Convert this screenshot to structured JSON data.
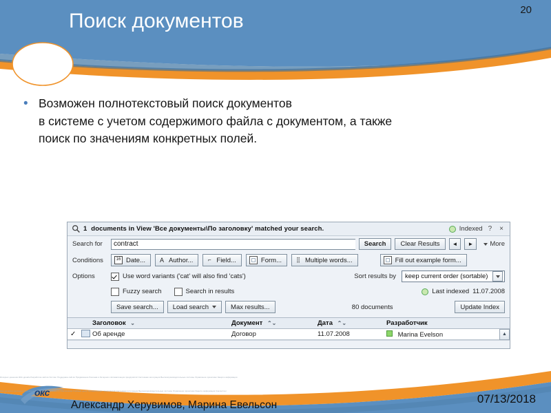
{
  "slide": {
    "title": "Поиск документов",
    "page_number": "20",
    "accent_blue": "#5b8fc0",
    "accent_orange": "#f0932a",
    "bullet_text": "Возможен полнотекстовый поиск документов\nв системе с учетом содержимого файла с документом, а также\nпоиск по значениям конкретных полей."
  },
  "search_panel": {
    "status": {
      "icon": "magnifier-icon",
      "count": "1",
      "message": "documents in View 'Все документы\\По заголовку' matched your search.",
      "indexed_label": "Indexed",
      "indexed_state": "green",
      "help_glyph": "?",
      "close_glyph": "×"
    },
    "search_row": {
      "label": "Search for",
      "value": "contract",
      "placeholder": "",
      "search_button": "Search",
      "clear_button": "Clear Results",
      "prev_arrow": "◄",
      "next_arrow": "►",
      "more_label": "More"
    },
    "conditions": {
      "label": "Conditions",
      "buttons": [
        {
          "icon": "calendar-icon",
          "glyph": "16",
          "label": "Date..."
        },
        {
          "icon": "author-icon",
          "glyph": "A",
          "label": "Author..."
        },
        {
          "icon": "field-icon",
          "glyph": "⌐",
          "label": "Field..."
        },
        {
          "icon": "form-icon",
          "glyph": "",
          "label": "Form..."
        },
        {
          "icon": "multiple-words-icon",
          "glyph": "⣿",
          "label": "Multiple words..."
        },
        {
          "icon": "example-form-icon",
          "glyph": "",
          "label": "Fill out example form..."
        }
      ]
    },
    "options": {
      "label": "Options",
      "word_variants": {
        "label": "Use word variants ('cat' will also find 'cats')",
        "checked": true
      },
      "fuzzy_search": {
        "label": "Fuzzy search",
        "checked": false
      },
      "search_in_results": {
        "label": "Search in results",
        "checked": false
      },
      "sort_label": "Sort results by",
      "sort_value": "keep current order (sortable)",
      "last_indexed_label": "Last indexed",
      "last_indexed_date": "11.07.2008"
    },
    "actions": {
      "save_search": "Save search...",
      "load_search": "Load search",
      "max_results": "Max results...",
      "documents_count": "80",
      "documents_label": "documents",
      "update_index": "Update Index"
    },
    "results": {
      "columns": [
        "Заголовок",
        "Документ",
        "Дата",
        "Разработчик"
      ],
      "rows": [
        {
          "checked": "✓",
          "title": "Об аренде",
          "document": "Договор",
          "date": "11.07.2008",
          "developer": "Marina Evelson"
        }
      ]
    }
  },
  "footer": {
    "authors": "Александр Херувимов, Марина Евельсон",
    "date": "07/13/2018",
    "logo_text": "окс",
    "microtext_line1": "Интернет-решения Web-дизайн Разработка сайтов Хостинг Поддержка сайтов Продвижение Реклама в Интернете Автоматизация предприятий Системная интеграция Высокопроизводительные системы Управление проектами Защита информации",
    "microtext_line2": "Web-дизайн и реклама в Интернете Разработка программного обеспечения Учебный центр Автоматизация предприятий Системная интеграция Высокопроизводительные системы Управление проектами Защита информации Консалтинг"
  }
}
